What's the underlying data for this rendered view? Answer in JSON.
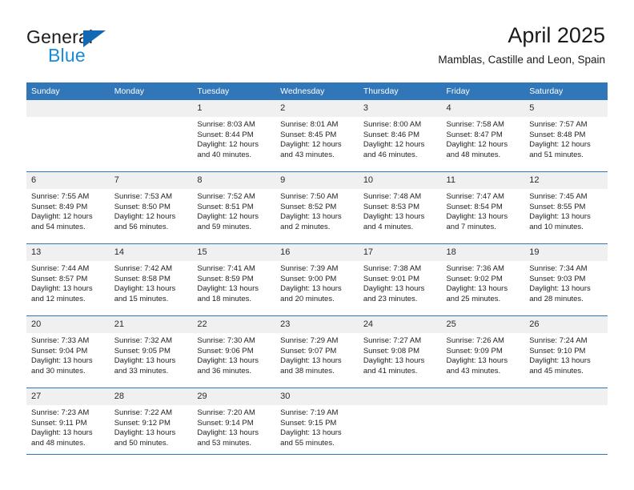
{
  "brand": {
    "name_part1": "General",
    "name_part2": "Blue",
    "triangle_icon": "triangle-right-icon",
    "accent_color": "#1268b3",
    "accent_color_light": "#1a8bd8"
  },
  "header": {
    "title": "April 2025",
    "subtitle": "Mamblas, Castille and Leon, Spain"
  },
  "theme": {
    "header_row_bg": "#3176b9",
    "daynum_bg": "#f0f0f0",
    "rule_color": "#3176b9"
  },
  "weekdays": [
    "Sunday",
    "Monday",
    "Tuesday",
    "Wednesday",
    "Thursday",
    "Friday",
    "Saturday"
  ],
  "weeks": [
    [
      {
        "day": "",
        "sunrise": "",
        "sunset": "",
        "daylight": ""
      },
      {
        "day": "",
        "sunrise": "",
        "sunset": "",
        "daylight": ""
      },
      {
        "day": "1",
        "sunrise": "Sunrise: 8:03 AM",
        "sunset": "Sunset: 8:44 PM",
        "daylight": "Daylight: 12 hours and 40 minutes."
      },
      {
        "day": "2",
        "sunrise": "Sunrise: 8:01 AM",
        "sunset": "Sunset: 8:45 PM",
        "daylight": "Daylight: 12 hours and 43 minutes."
      },
      {
        "day": "3",
        "sunrise": "Sunrise: 8:00 AM",
        "sunset": "Sunset: 8:46 PM",
        "daylight": "Daylight: 12 hours and 46 minutes."
      },
      {
        "day": "4",
        "sunrise": "Sunrise: 7:58 AM",
        "sunset": "Sunset: 8:47 PM",
        "daylight": "Daylight: 12 hours and 48 minutes."
      },
      {
        "day": "5",
        "sunrise": "Sunrise: 7:57 AM",
        "sunset": "Sunset: 8:48 PM",
        "daylight": "Daylight: 12 hours and 51 minutes."
      }
    ],
    [
      {
        "day": "6",
        "sunrise": "Sunrise: 7:55 AM",
        "sunset": "Sunset: 8:49 PM",
        "daylight": "Daylight: 12 hours and 54 minutes."
      },
      {
        "day": "7",
        "sunrise": "Sunrise: 7:53 AM",
        "sunset": "Sunset: 8:50 PM",
        "daylight": "Daylight: 12 hours and 56 minutes."
      },
      {
        "day": "8",
        "sunrise": "Sunrise: 7:52 AM",
        "sunset": "Sunset: 8:51 PM",
        "daylight": "Daylight: 12 hours and 59 minutes."
      },
      {
        "day": "9",
        "sunrise": "Sunrise: 7:50 AM",
        "sunset": "Sunset: 8:52 PM",
        "daylight": "Daylight: 13 hours and 2 minutes."
      },
      {
        "day": "10",
        "sunrise": "Sunrise: 7:48 AM",
        "sunset": "Sunset: 8:53 PM",
        "daylight": "Daylight: 13 hours and 4 minutes."
      },
      {
        "day": "11",
        "sunrise": "Sunrise: 7:47 AM",
        "sunset": "Sunset: 8:54 PM",
        "daylight": "Daylight: 13 hours and 7 minutes."
      },
      {
        "day": "12",
        "sunrise": "Sunrise: 7:45 AM",
        "sunset": "Sunset: 8:55 PM",
        "daylight": "Daylight: 13 hours and 10 minutes."
      }
    ],
    [
      {
        "day": "13",
        "sunrise": "Sunrise: 7:44 AM",
        "sunset": "Sunset: 8:57 PM",
        "daylight": "Daylight: 13 hours and 12 minutes."
      },
      {
        "day": "14",
        "sunrise": "Sunrise: 7:42 AM",
        "sunset": "Sunset: 8:58 PM",
        "daylight": "Daylight: 13 hours and 15 minutes."
      },
      {
        "day": "15",
        "sunrise": "Sunrise: 7:41 AM",
        "sunset": "Sunset: 8:59 PM",
        "daylight": "Daylight: 13 hours and 18 minutes."
      },
      {
        "day": "16",
        "sunrise": "Sunrise: 7:39 AM",
        "sunset": "Sunset: 9:00 PM",
        "daylight": "Daylight: 13 hours and 20 minutes."
      },
      {
        "day": "17",
        "sunrise": "Sunrise: 7:38 AM",
        "sunset": "Sunset: 9:01 PM",
        "daylight": "Daylight: 13 hours and 23 minutes."
      },
      {
        "day": "18",
        "sunrise": "Sunrise: 7:36 AM",
        "sunset": "Sunset: 9:02 PM",
        "daylight": "Daylight: 13 hours and 25 minutes."
      },
      {
        "day": "19",
        "sunrise": "Sunrise: 7:34 AM",
        "sunset": "Sunset: 9:03 PM",
        "daylight": "Daylight: 13 hours and 28 minutes."
      }
    ],
    [
      {
        "day": "20",
        "sunrise": "Sunrise: 7:33 AM",
        "sunset": "Sunset: 9:04 PM",
        "daylight": "Daylight: 13 hours and 30 minutes."
      },
      {
        "day": "21",
        "sunrise": "Sunrise: 7:32 AM",
        "sunset": "Sunset: 9:05 PM",
        "daylight": "Daylight: 13 hours and 33 minutes."
      },
      {
        "day": "22",
        "sunrise": "Sunrise: 7:30 AM",
        "sunset": "Sunset: 9:06 PM",
        "daylight": "Daylight: 13 hours and 36 minutes."
      },
      {
        "day": "23",
        "sunrise": "Sunrise: 7:29 AM",
        "sunset": "Sunset: 9:07 PM",
        "daylight": "Daylight: 13 hours and 38 minutes."
      },
      {
        "day": "24",
        "sunrise": "Sunrise: 7:27 AM",
        "sunset": "Sunset: 9:08 PM",
        "daylight": "Daylight: 13 hours and 41 minutes."
      },
      {
        "day": "25",
        "sunrise": "Sunrise: 7:26 AM",
        "sunset": "Sunset: 9:09 PM",
        "daylight": "Daylight: 13 hours and 43 minutes."
      },
      {
        "day": "26",
        "sunrise": "Sunrise: 7:24 AM",
        "sunset": "Sunset: 9:10 PM",
        "daylight": "Daylight: 13 hours and 45 minutes."
      }
    ],
    [
      {
        "day": "27",
        "sunrise": "Sunrise: 7:23 AM",
        "sunset": "Sunset: 9:11 PM",
        "daylight": "Daylight: 13 hours and 48 minutes."
      },
      {
        "day": "28",
        "sunrise": "Sunrise: 7:22 AM",
        "sunset": "Sunset: 9:12 PM",
        "daylight": "Daylight: 13 hours and 50 minutes."
      },
      {
        "day": "29",
        "sunrise": "Sunrise: 7:20 AM",
        "sunset": "Sunset: 9:14 PM",
        "daylight": "Daylight: 13 hours and 53 minutes."
      },
      {
        "day": "30",
        "sunrise": "Sunrise: 7:19 AM",
        "sunset": "Sunset: 9:15 PM",
        "daylight": "Daylight: 13 hours and 55 minutes."
      },
      {
        "day": "",
        "sunrise": "",
        "sunset": "",
        "daylight": ""
      },
      {
        "day": "",
        "sunrise": "",
        "sunset": "",
        "daylight": ""
      },
      {
        "day": "",
        "sunrise": "",
        "sunset": "",
        "daylight": ""
      }
    ]
  ]
}
